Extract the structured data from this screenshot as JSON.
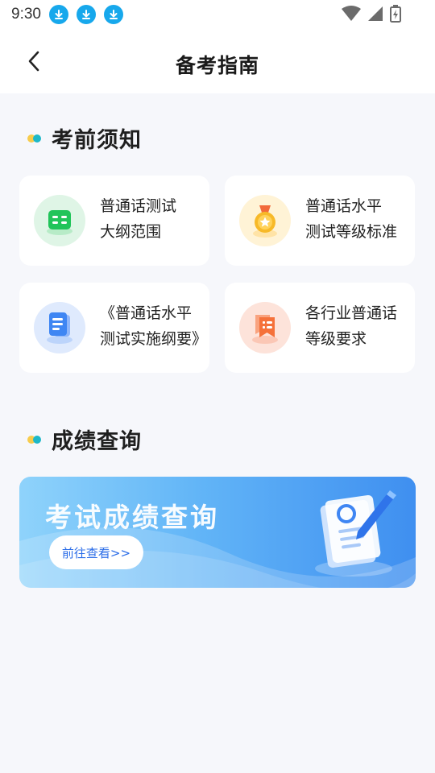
{
  "status_bar": {
    "time": "9:30",
    "download_icons": [
      "download-icon",
      "download-icon",
      "download-icon"
    ]
  },
  "header": {
    "title": "备考指南",
    "back_icon": "chevron-left-icon"
  },
  "exam_notes": {
    "section_title": "考前须知",
    "cards": [
      {
        "line1": "普通话测试",
        "line2": "大纲范围",
        "icon": "book-icon",
        "icon_color": "#21c45a"
      },
      {
        "line1": "普通话水平",
        "line2": "测试等级标准",
        "icon": "medal-icon",
        "icon_color": "#f7b928"
      },
      {
        "line1": "《普通话水平",
        "line2": "测试实施纲要》",
        "icon": "document-icon",
        "icon_color": "#3f86f3"
      },
      {
        "line1": "各行业普通话",
        "line2": "等级要求",
        "icon": "bookmark-list-icon",
        "icon_color": "#f5713a"
      }
    ]
  },
  "score_query": {
    "section_title": "成绩查询",
    "banner_title": "考试成绩查询",
    "banner_button": "前往查看>>"
  },
  "colors": {
    "background": "#f6f7fb",
    "accent_blue": "#3f8ff0",
    "dot_yellow": "#f7cc4c",
    "dot_teal": "#1db8c8"
  }
}
